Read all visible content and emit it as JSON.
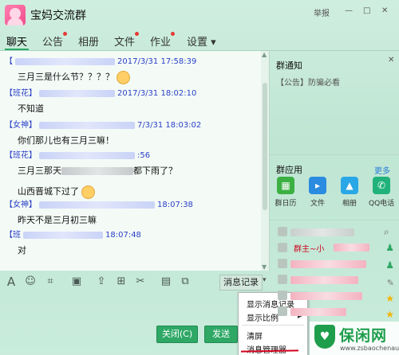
{
  "window": {
    "title": "宝妈交流群",
    "report_label": "举报",
    "controls": [
      "—",
      "□",
      "✕"
    ]
  },
  "tabs": [
    {
      "label": "聊天",
      "active": true,
      "badge": false
    },
    {
      "label": "公告",
      "active": false,
      "badge": true
    },
    {
      "label": "相册",
      "active": false,
      "badge": false
    },
    {
      "label": "文件",
      "active": false,
      "badge": true
    },
    {
      "label": "作业",
      "active": false,
      "badge": true
    },
    {
      "label": "设置 ▾",
      "active": false,
      "badge": false
    }
  ],
  "messages": [
    {
      "tag": "【",
      "timestamp": "2017/3/31 17:58:39",
      "text": "三月三是什么节？？？？"
    },
    {
      "tag": "【班花】",
      "timestamp": "2017/3/31 18:02:10",
      "text": "不知道"
    },
    {
      "tag": "【女神】",
      "timestamp": "7/3/31 18:03:02",
      "text": "你们那儿也有三月三嘛！"
    },
    {
      "tag": "【班花】",
      "timestamp": ":56",
      "text": "三月三那天",
      "text_tail": "都下雨了？"
    },
    {
      "tag": "",
      "timestamp": "",
      "text": "山西晋城下过了"
    },
    {
      "tag": "【女神】",
      "timestamp": "18:07:38",
      "text": "昨天不是三月初三嘛"
    },
    {
      "tag": "【班",
      "timestamp": "18:07:48",
      "text": "对"
    }
  ],
  "toolbar": {
    "history_label": "消息记录",
    "icons": [
      "font-icon",
      "emoji-icon",
      "clip-icon",
      "image-icon",
      "upload-icon",
      "gift-icon",
      "scissors-icon",
      "trash-icon",
      "screen-icon"
    ]
  },
  "dropdown_menu": {
    "items": [
      "显示消息记录",
      "显示比例",
      "清屏",
      "消息管理器"
    ]
  },
  "buttons": {
    "close": "关闭(C)",
    "send": "发送"
  },
  "right_panel": {
    "notice_title": "群通知",
    "notice_text": "【公告】防骗必看",
    "apps_title": "群应用",
    "more_label": "更多",
    "apps": [
      {
        "label": "群日历",
        "icon": "calendar-icon",
        "color": "#3cb043"
      },
      {
        "label": "文件",
        "icon": "folder-icon",
        "color": "#2a8be0"
      },
      {
        "label": "相册",
        "icon": "photo-icon",
        "color": "#2aa7e6"
      },
      {
        "label": "QQ电话",
        "icon": "phone-icon",
        "color": "#20b27a"
      }
    ],
    "member_label_fragment": "群主~小"
  },
  "watermark": {
    "title": "保闲网",
    "url": "www.zsbaochenau.com"
  },
  "colors": {
    "accent_green": "#2fa866",
    "timestamp_blue": "#2a3fc7",
    "badge_red": "#e53935"
  }
}
